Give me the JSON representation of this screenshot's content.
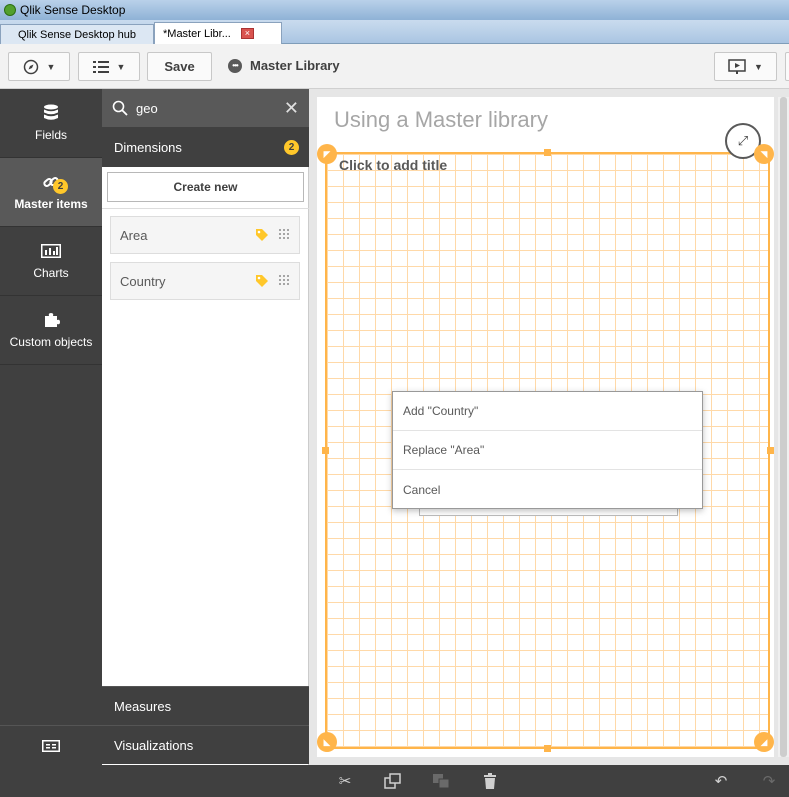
{
  "window": {
    "title": "Qlik Sense Desktop"
  },
  "tabs": [
    {
      "label": "Qlik Sense Desktop hub"
    },
    {
      "label": "*Master Libr...",
      "close": "×"
    }
  ],
  "toolbar": {
    "save_label": "Save",
    "sheet_title": "Master Library",
    "menu_caret": "▼",
    "list_caret": "▼",
    "present_caret": "▼"
  },
  "leftnav": {
    "items": [
      {
        "label": "Fields",
        "icon": "database-icon"
      },
      {
        "label": "Master items",
        "icon": "link-icon",
        "badge": "2"
      },
      {
        "label": "Charts",
        "icon": "bar-chart-icon"
      },
      {
        "label": "Custom objects",
        "icon": "puzzle-icon"
      }
    ]
  },
  "panel": {
    "search_value": "geo",
    "dimensions_label": "Dimensions",
    "dimensions_badge": "2",
    "create_new": "Create new",
    "dimension_items": [
      {
        "label": "Area"
      },
      {
        "label": "Country"
      }
    ],
    "measures_label": "Measures",
    "visualizations_label": "Visualizations"
  },
  "sheet": {
    "heading": "Using a Master library",
    "object_title": "Click to add title"
  },
  "context_menu": {
    "items": [
      {
        "label": "Add \"Country\""
      },
      {
        "label": "Replace \"Area\""
      },
      {
        "label": "Cancel"
      }
    ]
  },
  "colors": {
    "accent": "#ffb54a",
    "badge": "#ffc72a",
    "nav_bg": "#404040",
    "nav_active": "#595959"
  }
}
